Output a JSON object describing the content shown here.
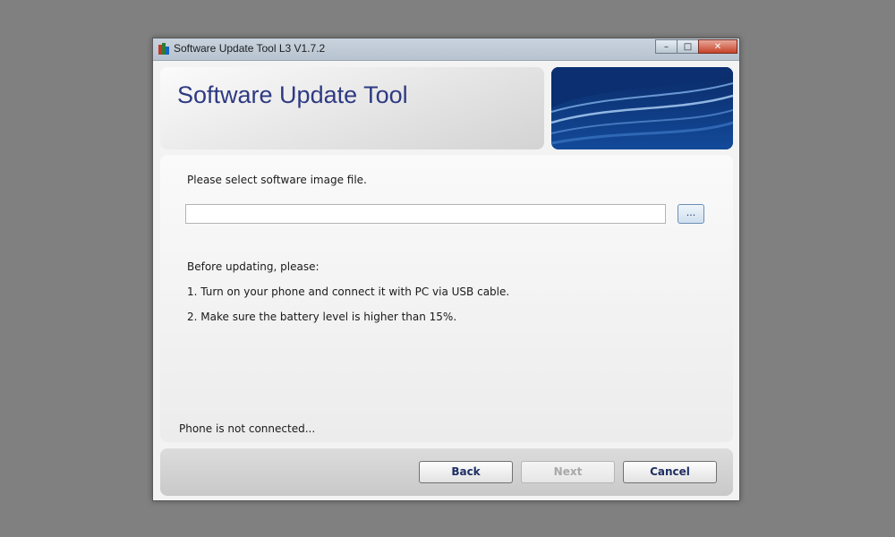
{
  "window": {
    "title": "Software Update Tool L3 V1.7.2",
    "controls": {
      "minimize": "–",
      "maximize": "□",
      "close": "✕"
    }
  },
  "header": {
    "title": "Software Update Tool"
  },
  "main": {
    "prompt": "Please select software image file.",
    "file_input": {
      "value": "",
      "placeholder": ""
    },
    "browse_label": "...",
    "instructions_heading": "Before updating, please:",
    "steps": [
      "1. Turn on your phone and connect it with PC via USB cable.",
      "2. Make sure the battery level is higher than 15%."
    ],
    "status": "Phone is not connected..."
  },
  "footer": {
    "back_label": "Back",
    "next_label": "Next",
    "cancel_label": "Cancel"
  },
  "colors": {
    "title_text": "#2e3a82",
    "banner_blue": "#0c3473",
    "button_text": "#1f2f63",
    "disabled_text": "#a8a8a8"
  },
  "icons": {
    "app": "app-icon",
    "banner": "blue-wave-banner"
  }
}
